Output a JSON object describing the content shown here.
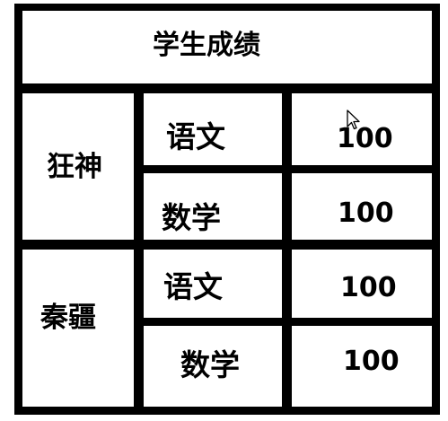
{
  "table": {
    "header": "学生成绩",
    "students": [
      {
        "name": "狂神",
        "rows": [
          {
            "subject": "语文",
            "score": "100"
          },
          {
            "subject": "数学",
            "score": "100"
          }
        ]
      },
      {
        "name": "秦疆",
        "rows": [
          {
            "subject": "语文",
            "score": "100"
          },
          {
            "subject": "数学",
            "score": "100"
          }
        ]
      }
    ]
  },
  "cursor_icon": "mouse-pointer-icon"
}
